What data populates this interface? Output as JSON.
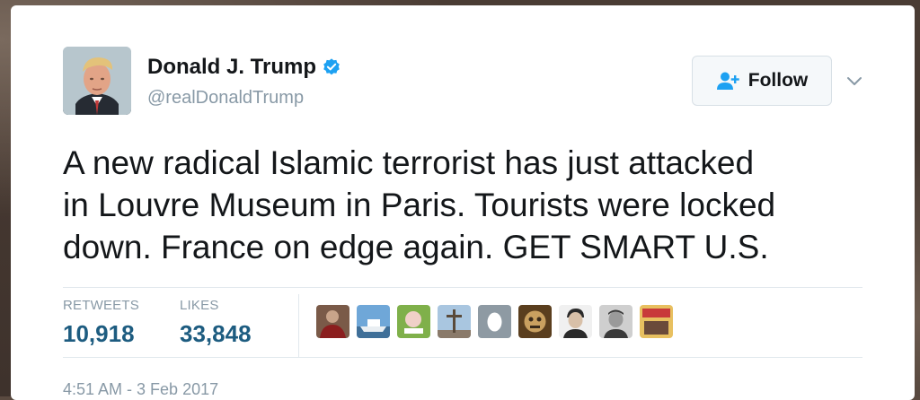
{
  "user": {
    "name": "Donald J. Trump",
    "handle": "@realDonaldTrump"
  },
  "follow_button": {
    "label": "Follow"
  },
  "tweet": {
    "lines": [
      "A new radical Islamic terrorist has just attacked",
      "in Louvre Museum in Paris. Tourists were locked",
      "down. France on edge again. GET SMART U.S."
    ],
    "timestamp": "4:51 AM - 3 Feb 2017"
  },
  "stats": {
    "retweets_label": "RETWEETS",
    "retweets_value": "10,918",
    "likes_label": "LIKES",
    "likes_value": "33,848"
  },
  "colors": {
    "link_blue": "#1d5c80",
    "muted_gray": "#8899a6",
    "verified_blue": "#1da1f2",
    "follow_icon_blue": "#1da1f2"
  },
  "icons": [
    "verified-badge-icon",
    "add-user-icon",
    "chevron-down-icon"
  ],
  "likers": [
    {
      "icon": "liker-avatar-person-red",
      "colors": [
        "#8b1e1e",
        "#c9a48a"
      ]
    },
    {
      "icon": "liker-avatar-boat",
      "colors": [
        "#6fa7d8",
        "#e9eef2"
      ]
    },
    {
      "icon": "liker-avatar-cartoon",
      "colors": [
        "#7fb04a",
        "#f0d0c8"
      ]
    },
    {
      "icon": "liker-avatar-cross",
      "colors": [
        "#a9c6e0",
        "#5a4a3a"
      ]
    },
    {
      "icon": "liker-avatar-egg",
      "colors": [
        "#8e9aa3",
        "#ffffff"
      ]
    },
    {
      "icon": "liker-avatar-mask",
      "colors": [
        "#5a3e1e",
        "#c9a060"
      ]
    },
    {
      "icon": "liker-avatar-person-bw",
      "colors": [
        "#f0f0f0",
        "#2a2a2a"
      ]
    },
    {
      "icon": "liker-avatar-person-gray",
      "colors": [
        "#cfcfcf",
        "#3a3a3a"
      ]
    },
    {
      "icon": "liker-avatar-sign",
      "colors": [
        "#c83a3a",
        "#e8c060"
      ]
    }
  ]
}
